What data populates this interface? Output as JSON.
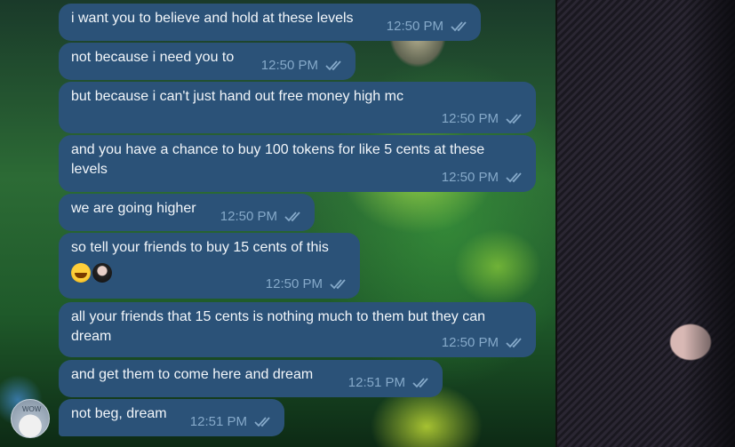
{
  "messages": [
    {
      "text": "i want you to believe and hold at these levels",
      "time": "12:50 PM"
    },
    {
      "text": "not because i need you to",
      "time": "12:50 PM"
    },
    {
      "text": "but because i can't just hand out free money high mc",
      "time": "12:50 PM"
    },
    {
      "text": "and you have a chance to buy 100 tokens for like 5 cents at these levels",
      "time": "12:50 PM"
    },
    {
      "text": "we are going higher",
      "time": "12:50 PM"
    },
    {
      "text": "so tell your friends to buy 15 cents of this",
      "time": "12:50 PM",
      "reactions": [
        "crying-face-emoji",
        "user-avatar"
      ]
    },
    {
      "text": "all your friends that 15 cents is nothing much to them but they can dream",
      "time": "12:50 PM"
    },
    {
      "text": "and get them to come here and dream",
      "time": "12:51 PM"
    },
    {
      "text": "not beg, dream",
      "time": "12:51 PM"
    }
  ],
  "sender_avatar_label": "WOW",
  "colors": {
    "bubble": "#2b5278",
    "meta": "#85a9c9",
    "text": "#f2f6fa"
  }
}
